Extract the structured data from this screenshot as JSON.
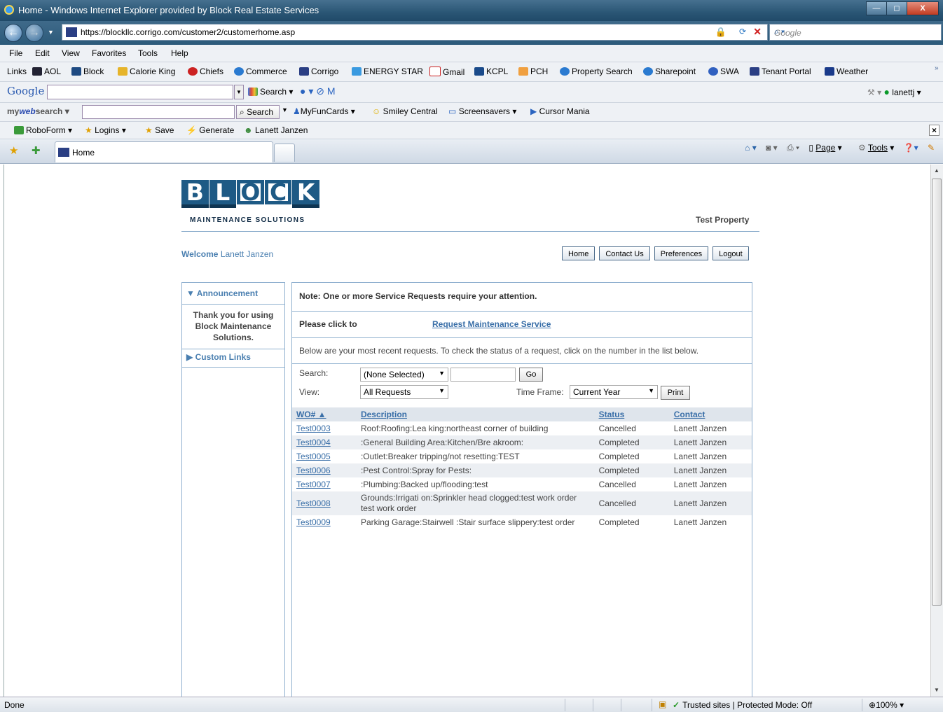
{
  "window": {
    "title": "Home - Windows Internet Explorer provided by Block Real Estate Services",
    "min": "—",
    "max": "◻",
    "close": "X"
  },
  "address": {
    "url": "https://blockllc.corrigo.com/customer2/customerhome.asp",
    "search_placeholder": "Google"
  },
  "menu": [
    "File",
    "Edit",
    "View",
    "Favorites",
    "Tools",
    "Help"
  ],
  "links_bar": {
    "label": "Links",
    "items": [
      "AOL",
      "Block",
      "Calorie King",
      "Chiefs",
      "Commerce",
      "Corrigo",
      "ENERGY STAR",
      "Gmail",
      "KCPL",
      "PCH",
      "Property Search",
      "Sharepoint",
      "SWA",
      "Tenant Portal",
      "Weather"
    ]
  },
  "google_bar": {
    "logo": "Google",
    "search": "Search",
    "user": "lanettj"
  },
  "mywebsearch": {
    "logo_a": "my",
    "logo_b": "web",
    "logo_c": "search",
    "search": "Search",
    "items": [
      "MyFunCards",
      "Smiley Central",
      "Screensavers",
      "Cursor Mania"
    ]
  },
  "roboform": {
    "items": [
      "RoboForm",
      "Logins",
      "Save",
      "Generate",
      "Lanett Janzen"
    ]
  },
  "tab": {
    "label": "Home"
  },
  "commandbar": {
    "page": "Page",
    "tools": "Tools"
  },
  "page": {
    "logo_letters": [
      "B",
      "L",
      "O",
      "C",
      "K"
    ],
    "tagline": "MAINTENANCE SOLUTIONS",
    "property": "Test Property",
    "welcome_word": "Welcome",
    "welcome_name": "Lanett Janzen",
    "nav_buttons": [
      "Home",
      "Contact Us",
      "Preferences",
      "Logout"
    ],
    "announcement_title": "Announcement",
    "announcement_text": "Thank you for using Block Maintenance Solutions.",
    "custom_links": "Custom Links",
    "note": "Note: One or more Service Requests require your attention.",
    "please_click": "Please click to",
    "request_link": "Request Maintenance Service",
    "below_text": "Below are your most recent requests. To check the status of a request, click on the number in the list below.",
    "search_label": "Search:",
    "search_select": "(None Selected)",
    "go_button": "Go",
    "view_label": "View:",
    "view_select": "All Requests",
    "timeframe_label": "Time Frame:",
    "timeframe_select": "Current Year",
    "print_button": "Print",
    "columns": [
      "WO#",
      "Description",
      "Status",
      "Contact"
    ],
    "rows": [
      {
        "wo": "Test0003",
        "desc": "Roof:Roofing:Lea king:northeast corner of building",
        "status": "Cancelled",
        "contact": "Lanett Janzen"
      },
      {
        "wo": "Test0004",
        "desc": ":General Building Area:Kitchen/Bre akroom:",
        "status": "Completed",
        "contact": "Lanett Janzen"
      },
      {
        "wo": "Test0005",
        "desc": ":Outlet:Breaker tripping/not resetting:TEST",
        "status": "Completed",
        "contact": "Lanett Janzen"
      },
      {
        "wo": "Test0006",
        "desc": ":Pest Control:Spray for Pests:",
        "status": "Completed",
        "contact": "Lanett Janzen"
      },
      {
        "wo": "Test0007",
        "desc": ":Plumbing:Backed up/flooding:test",
        "status": "Cancelled",
        "contact": "Lanett Janzen"
      },
      {
        "wo": "Test0008",
        "desc": "Grounds:Irrigati on:Sprinkler head clogged:test work order test work order",
        "status": "Cancelled",
        "contact": "Lanett Janzen"
      },
      {
        "wo": "Test0009",
        "desc": "Parking Garage:Stairwell :Stair surface slippery:test order",
        "status": "Completed",
        "contact": "Lanett Janzen"
      }
    ]
  },
  "status": {
    "done": "Done",
    "zone": "Trusted sites | Protected Mode: Off",
    "zoom": "100%"
  }
}
